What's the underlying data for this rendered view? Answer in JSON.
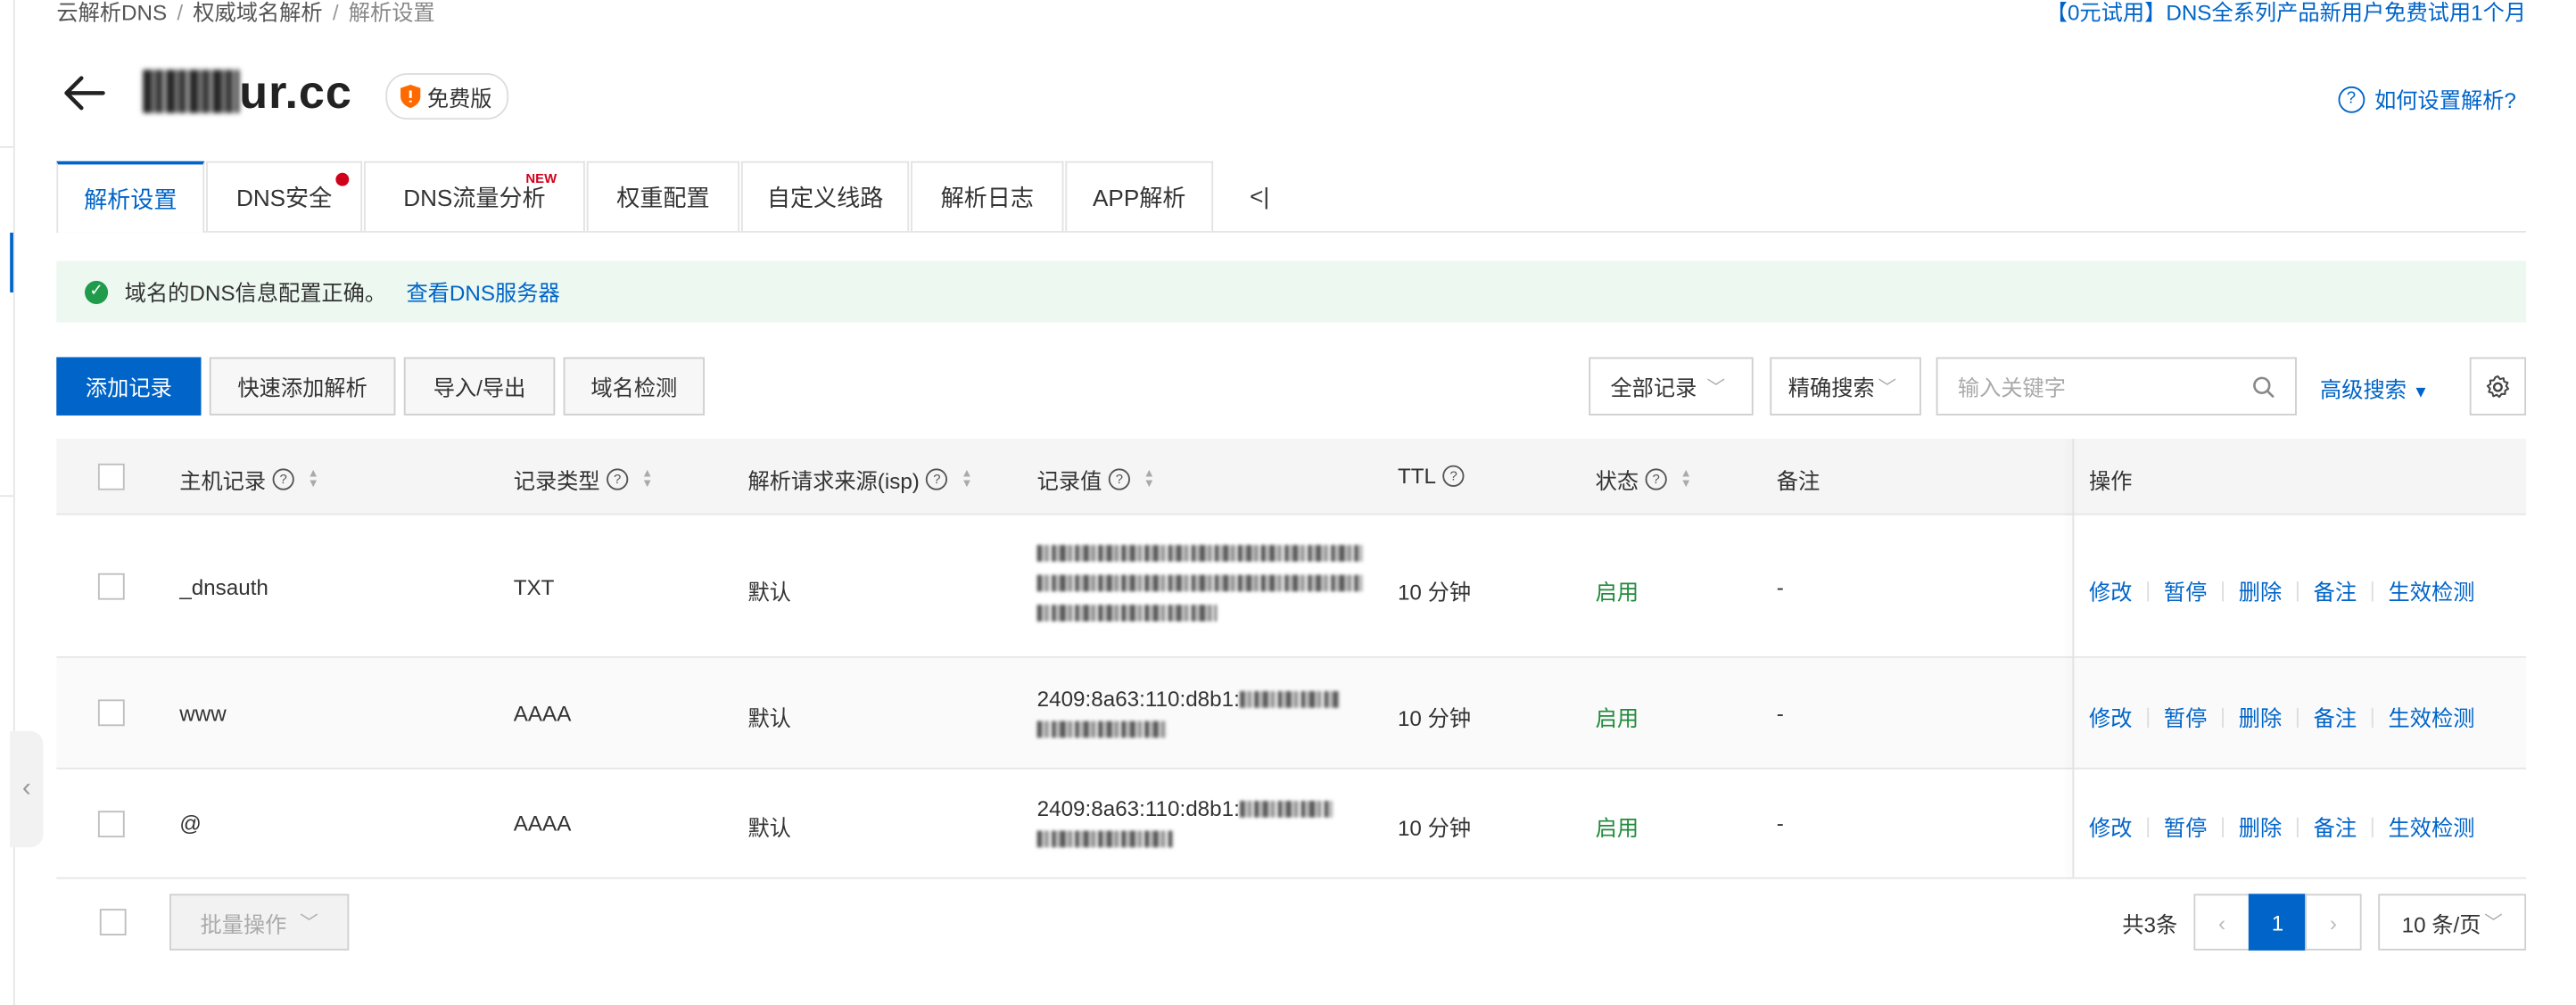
{
  "breadcrumb": [
    "云解析DNS",
    "权威域名解析",
    "解析设置"
  ],
  "promo": "【0元试用】DNS全系列产品新用户免费试用1个月",
  "header": {
    "domain_suffix": "ur.cc",
    "badge": "免费版",
    "help": "如何设置解析?"
  },
  "tabs": [
    {
      "label": "解析设置",
      "active": true
    },
    {
      "label": "DNS安全",
      "dot": true
    },
    {
      "label": "DNS流量分析",
      "tag": "NEW"
    },
    {
      "label": "权重配置"
    },
    {
      "label": "自定义线路"
    },
    {
      "label": "解析日志"
    },
    {
      "label": "APP解析"
    }
  ],
  "tabs_collapse": "<|",
  "notice": {
    "text": "域名的DNS信息配置正确。",
    "link": "查看DNS服务器"
  },
  "toolbar": {
    "add": "添加记录",
    "quick_add": "快速添加解析",
    "import_export": "导入/导出",
    "check": "域名检测",
    "filter": "全部记录",
    "search_mode": "精确搜索",
    "search_placeholder": "输入关键字",
    "advanced": "高级搜索"
  },
  "columns": [
    "主机记录",
    "记录类型",
    "解析请求来源(isp)",
    "记录值",
    "TTL",
    "状态",
    "备注",
    "操作"
  ],
  "rows": [
    {
      "host": "_dnsauth",
      "type": "TXT",
      "isp": "默认",
      "value": "",
      "ttl": "10 分钟",
      "status": "启用",
      "remark": "-"
    },
    {
      "host": "www",
      "type": "AAAA",
      "isp": "默认",
      "value": "2409:8a63:110:d8b1:",
      "ttl": "10 分钟",
      "status": "启用",
      "remark": "-"
    },
    {
      "host": "@",
      "type": "AAAA",
      "isp": "默认",
      "value": "2409:8a63:110:d8b1:",
      "ttl": "10 分钟",
      "status": "启用",
      "remark": "-"
    }
  ],
  "ops": [
    "修改",
    "暂停",
    "删除",
    "备注",
    "生效检测"
  ],
  "footer": {
    "batch": "批量操作",
    "total": "共3条",
    "page": "1",
    "page_size": "10 条/页"
  },
  "colors": {
    "primary": "#0064c8",
    "success": "#1f8a3a",
    "notice_bg": "#ecf8f0",
    "alert_dot": "#d0021b"
  }
}
